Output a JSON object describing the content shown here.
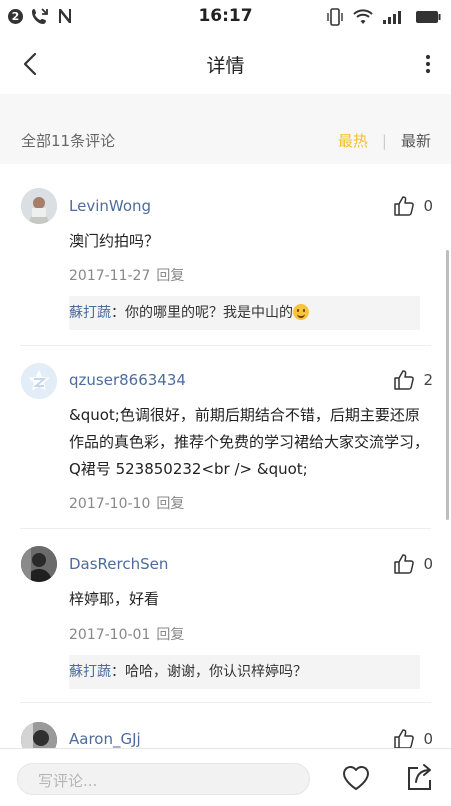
{
  "status_bar": {
    "badge": "2",
    "time": "16:17"
  },
  "nav": {
    "title": "详情"
  },
  "comments_header": {
    "count_text": "全部11条评论",
    "sort_hot": "最热",
    "sort_sep": "|",
    "sort_new": "最新"
  },
  "comments": [
    {
      "user": "LevinWong",
      "likes": "0",
      "text": "澳门约拍吗？",
      "date": "2017-11-27",
      "reply_label": "回复",
      "reply": {
        "name": "蘇打蔬",
        "sep": "：",
        "text": "你的哪里的呢？我是中山的"
      }
    },
    {
      "user": "qzuser8663434",
      "likes": "2",
      "text": "&quot;色调很好，前期后期结合不错，后期主要还原作品的真色彩，推荐个免费的学习裙给大家交流学习，Q裙号 523850232<br /> &quot;",
      "date": "2017-10-10",
      "reply_label": "回复"
    },
    {
      "user": "DasRerchSen",
      "likes": "0",
      "text": "梓婷耶，好看",
      "date": "2017-10-01",
      "reply_label": "回复",
      "reply": {
        "name": "蘇打蔬",
        "sep": "：",
        "text": "哈哈，谢谢，你认识梓婷吗？"
      }
    },
    {
      "user": "Aaron_GJj",
      "likes": "0"
    }
  ],
  "bottom_bar": {
    "placeholder": "写评论..."
  },
  "icons": {
    "back": "chevron-left-icon",
    "more": "more-vertical-icon",
    "like": "thumbs-up-icon",
    "heart": "heart-icon",
    "share": "share-icon",
    "emoji": "grin-emoji-icon"
  },
  "colors": {
    "accent_hot": "#f5c02f",
    "username": "#4d6c9c",
    "muted": "#888888"
  }
}
